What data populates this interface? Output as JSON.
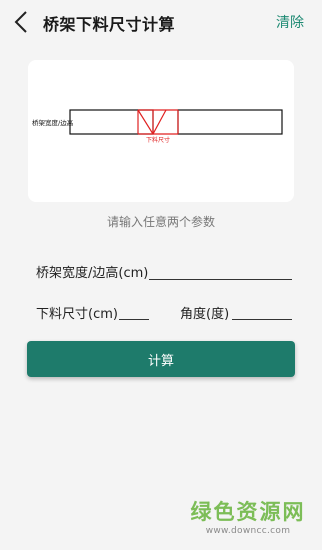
{
  "header": {
    "title": "桥架下料尺寸计算",
    "clear_label": "清除"
  },
  "diagram": {
    "width_label": "桥架宽度/边高",
    "cut_label": "下料尺寸",
    "colors": {
      "line": "#111111",
      "cut": "#e02020"
    }
  },
  "hint": "请输入任意两个参数",
  "form": {
    "width_label": "桥架宽度/边高(cm)",
    "width_value": "",
    "cut_label": "下料尺寸(cm)",
    "cut_value": "",
    "angle_label": "角度(度)",
    "angle_value": ""
  },
  "calc_button": "计算",
  "watermark": {
    "title": "绿色资源网",
    "url": "www.downcc.com"
  },
  "colors": {
    "accent": "#1e7b6b",
    "clear_link": "#1e8a73",
    "background": "#f4f4f4",
    "watermark_green": "#68b43c"
  }
}
